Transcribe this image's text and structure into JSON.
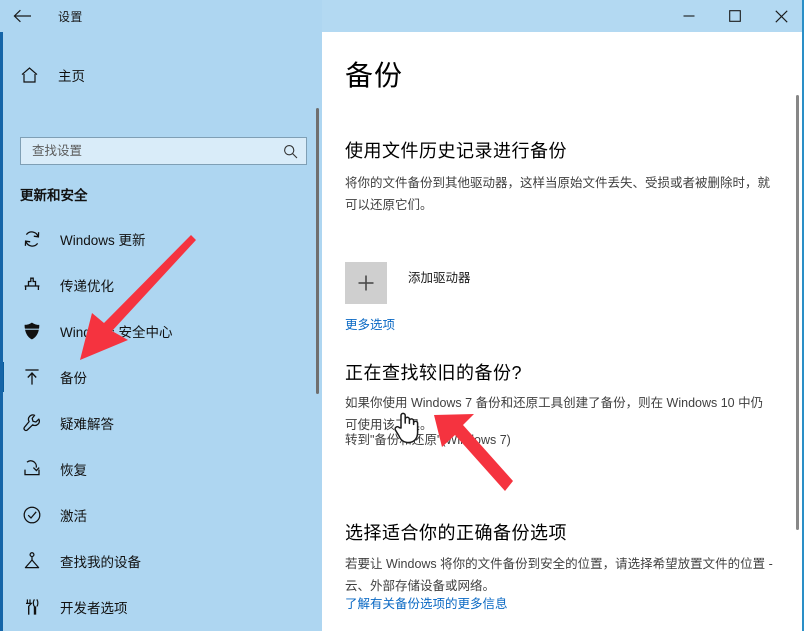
{
  "window": {
    "app_title": "设置",
    "back_icon": "back-arrow-icon",
    "controls": {
      "minimize": "minimize-icon",
      "maximize": "maximize-icon",
      "close": "close-icon"
    }
  },
  "sidebar": {
    "home_label": "主页",
    "home_icon": "home-icon",
    "search": {
      "placeholder": "查找设置",
      "value": "",
      "icon": "search-icon"
    },
    "group_heading": "更新和安全",
    "items": [
      {
        "label": "Windows 更新",
        "icon": "refresh-icon",
        "selected": false
      },
      {
        "label": "传递优化",
        "icon": "delivery-optimization-icon",
        "selected": false
      },
      {
        "label": "Windows 安全中心",
        "icon": "shield-icon",
        "selected": false
      },
      {
        "label": "备份",
        "icon": "backup-upload-icon",
        "selected": true
      },
      {
        "label": "疑难解答",
        "icon": "wrench-icon",
        "selected": false
      },
      {
        "label": "恢复",
        "icon": "recovery-icon",
        "selected": false
      },
      {
        "label": "激活",
        "icon": "check-circle-icon",
        "selected": false
      },
      {
        "label": "查找我的设备",
        "icon": "location-pin-icon",
        "selected": false
      },
      {
        "label": "开发者选项",
        "icon": "developer-tools-icon",
        "selected": false
      }
    ]
  },
  "main": {
    "page_title": "备份",
    "sections": [
      {
        "heading": "使用文件历史记录进行备份",
        "body": "将你的文件备份到其他驱动器，这样当原始文件丢失、受损或者被删除时，就可以还原它们。",
        "add_drive_label": "添加驱动器",
        "add_drive_icon": "plus-icon",
        "more_options_link": "更多选项"
      },
      {
        "heading": "正在查找较旧的备份?",
        "body": "如果你使用 Windows 7 备份和还原工具创建了备份，则在 Windows 10 中仍可使用该工具。",
        "w7_link": "转到\"备份和还原\"(Windows 7)"
      },
      {
        "heading": "选择适合你的正确备份选项",
        "body": "若要让 Windows 将你的文件备份到安全的位置，请选择希望放置文件的位置 - 云、外部存储设备或网络。",
        "learn_more_link": "了解有关备份选项的更多信息"
      }
    ]
  },
  "annotations": {
    "arrow_color": "#f5333f",
    "arrow_1_target": "备份",
    "arrow_2_target": "转到\"备份和还原\"(Windows 7)",
    "cursor": "hand-pointer-cursor"
  },
  "colors": {
    "sidebar_background": "#aed6f1",
    "titlebar_background": "#b3d9f2",
    "accent_blue": "#0a69c4",
    "selection_bar": "#0a5d9e",
    "annotation_red": "#f5333f"
  }
}
